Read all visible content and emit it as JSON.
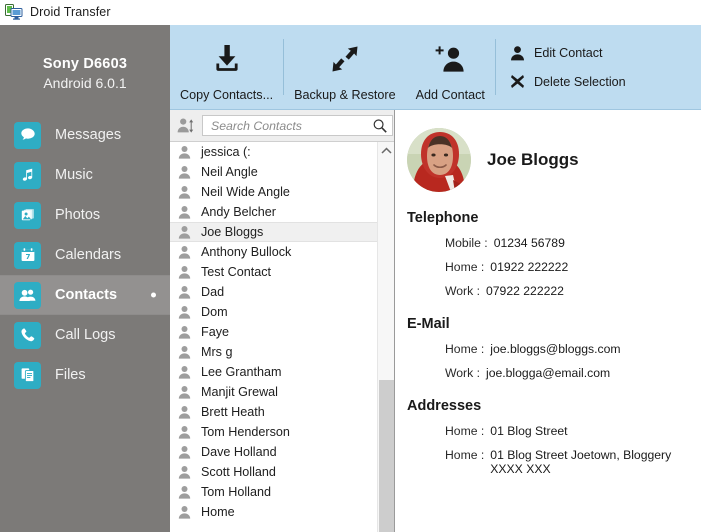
{
  "window": {
    "title": "Droid Transfer",
    "icon": "droid-transfer-icon"
  },
  "device": {
    "name": "Sony D6603",
    "os": "Android 6.0.1"
  },
  "sidebar": {
    "items": [
      {
        "label": "Messages",
        "icon": "messages-icon",
        "active": false
      },
      {
        "label": "Music",
        "icon": "music-icon",
        "active": false
      },
      {
        "label": "Photos",
        "icon": "photos-icon",
        "active": false
      },
      {
        "label": "Calendars",
        "icon": "calendar-icon",
        "active": false
      },
      {
        "label": "Contacts",
        "icon": "contacts-icon",
        "active": true
      },
      {
        "label": "Call Logs",
        "icon": "phone-icon",
        "active": false
      },
      {
        "label": "Files",
        "icon": "files-icon",
        "active": false
      }
    ]
  },
  "toolbar": {
    "buttons": [
      {
        "label": "Copy Contacts...",
        "icon": "download-icon"
      },
      {
        "label": "Backup & Restore",
        "icon": "backup-restore-arrows-icon"
      },
      {
        "label": "Add Contact",
        "icon": "add-person-icon"
      }
    ],
    "actions": [
      {
        "label": "Edit Contact",
        "icon": "person-icon"
      },
      {
        "label": "Delete Selection",
        "icon": "x-cross-icon"
      }
    ]
  },
  "search": {
    "placeholder": "Search Contacts",
    "value": "",
    "sort_icon": "sort-people-icon",
    "magnifier_icon": "search-icon"
  },
  "contacts": {
    "selected": "Joe Bloggs",
    "items": [
      "jessica (:",
      "Neil Angle",
      "Neil Wide Angle",
      "Andy Belcher",
      "Joe Bloggs",
      "Anthony Bullock",
      "Test Contact",
      "Dad",
      "Dom",
      "Faye",
      "Mrs g",
      "Lee Grantham",
      "Manjit Grewal",
      "Brett Heath",
      "Tom Henderson",
      "Dave Holland",
      "Scott Holland",
      "Tom Holland",
      "Home"
    ]
  },
  "detail": {
    "name": "Joe Bloggs",
    "avatar_icon": "contact-photo",
    "sections": [
      {
        "title": "Telephone",
        "fields": [
          {
            "label": "Mobile :",
            "value": "01234 56789"
          },
          {
            "label": "Home :",
            "value": "01922 222222"
          },
          {
            "label": "Work :",
            "value": "07922 222222"
          }
        ]
      },
      {
        "title": "E-Mail",
        "fields": [
          {
            "label": "Home :",
            "value": "joe.bloggs@bloggs.com"
          },
          {
            "label": "Work :",
            "value": "joe.blogga@email.com"
          }
        ]
      },
      {
        "title": "Addresses",
        "fields": [
          {
            "label": "Home :",
            "value": "01 Blog Street"
          },
          {
            "label": "Home :",
            "value": "01 Blog Street Joetown, Bloggery",
            "value2": "XXXX XXX"
          }
        ]
      }
    ]
  },
  "colors": {
    "sidebar_bg": "#7c7a78",
    "sidebar_active": "#939190",
    "accent_teal": "#2eadc4",
    "toolbar_bg": "#bedcf0",
    "list_selected": "#f0f0f0"
  }
}
